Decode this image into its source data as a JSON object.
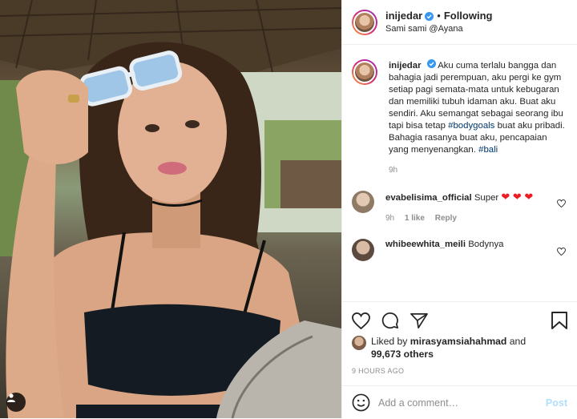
{
  "header": {
    "username": "inijedar",
    "follow_label": "Following",
    "dot": "•",
    "location": "Sami sami @Ayana"
  },
  "caption": {
    "username": "inijedar",
    "text_1": "Aku cuma terlalu bangga dan bahagia jadi perempuan, aku pergi ke gym setiap pagi semata-mata untuk kebugaran dan memiliki tubuh idaman aku. Buat aku sendiri. Aku semangat sebagai seorang ibu tapi bisa tetap",
    "tag_1": "#bodygoals",
    "text_2": "buat aku pribadi. Bahagia rasanya buat aku, pencapaian yang menyenangkan.",
    "tag_2": "#bali",
    "time": "9h"
  },
  "comments": [
    {
      "username": "evabelisima_official",
      "text": "Super",
      "hearts": "❤ ❤ ❤",
      "time": "9h",
      "likes": "1 like",
      "reply": "Reply"
    },
    {
      "username": "whibeewhita_meili",
      "text": "Bodynya"
    }
  ],
  "likes": {
    "prefix": "Liked by",
    "user": "mirasyamsiahahmad",
    "and": "and",
    "count": "99,673 others"
  },
  "timestamp": "9 HOURS AGO",
  "add_comment": {
    "placeholder": "Add a comment…",
    "post_label": "Post"
  },
  "colors": {
    "verified": "#3897f0",
    "link": "#00376b",
    "heart": "#ed1c24",
    "post_disabled": "#b2dffc"
  },
  "icons": {
    "like": "heart-outline-icon",
    "comment": "comment-bubble-icon",
    "share": "paper-plane-icon",
    "save": "bookmark-icon",
    "emoji": "smiley-icon",
    "user_tag": "person-icon",
    "verified": "verified-badge-icon"
  }
}
